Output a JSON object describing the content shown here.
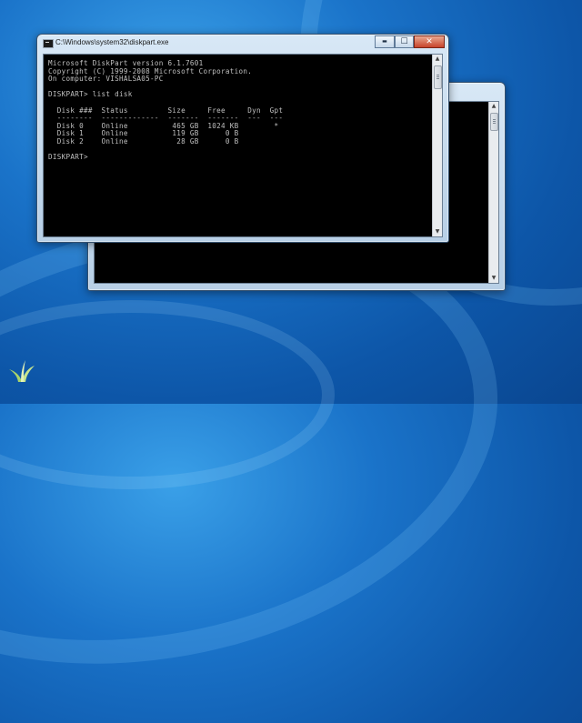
{
  "desktop": {
    "background_color": "#1a73c9"
  },
  "front_window": {
    "title": "C:\\Windows\\system32\\diskpart.exe",
    "icon": "console-icon",
    "controls": {
      "minimize": "▬",
      "maximize": "☐",
      "close": "✕"
    },
    "console_lines": [
      "Microsoft DiskPart version 6.1.7601",
      "Copyright (C) 1999-2008 Microsoft Corporation.",
      "On computer: VISHALSA05-PC",
      "",
      "DISKPART> list disk",
      "",
      "  Disk ###  Status         Size     Free     Dyn  Gpt",
      "  --------  -------------  -------  -------  ---  ---",
      "  Disk 0    Online          465 GB  1024 KB        *",
      "  Disk 1    Online          119 GB      0 B",
      "  Disk 2    Online           28 GB      0 B",
      "",
      "DISKPART> "
    ],
    "text_color": "#c0c0c0",
    "console_background": "#000000"
  },
  "back_window": {
    "icon": "console-icon",
    "console_background": "#000000"
  }
}
